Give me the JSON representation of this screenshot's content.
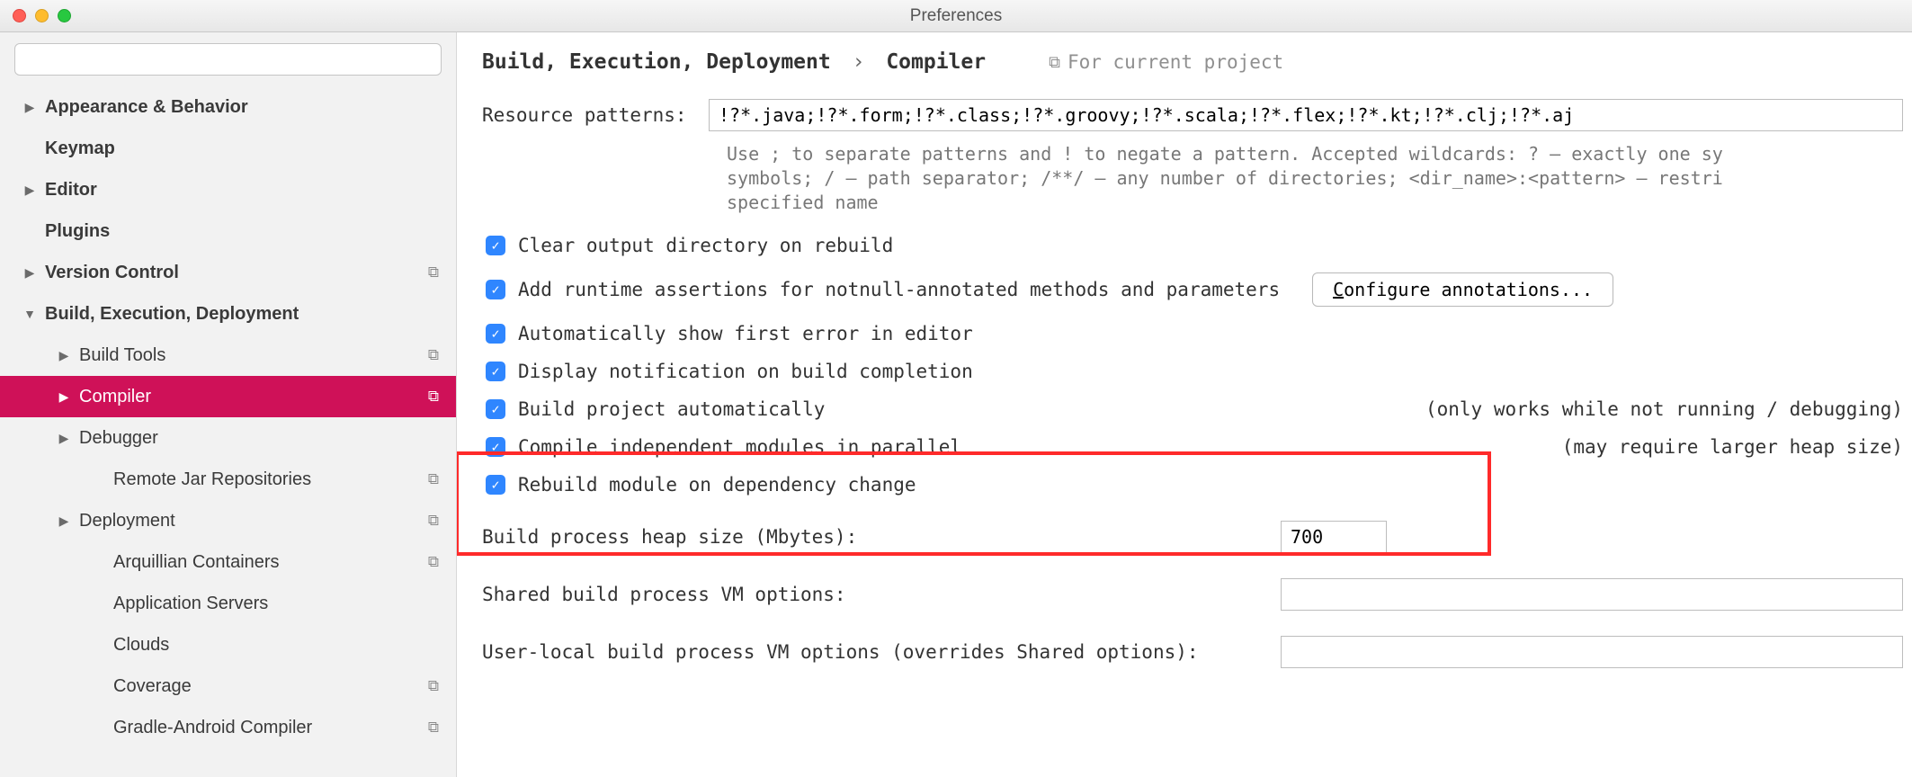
{
  "title": "Preferences",
  "search_placeholder": "",
  "sidebar": [
    {
      "label": "Appearance & Behavior",
      "bold": true,
      "arrow": "right",
      "lvl": 1
    },
    {
      "label": "Keymap",
      "bold": true,
      "arrow": "none",
      "lvl": 1
    },
    {
      "label": "Editor",
      "bold": true,
      "arrow": "right",
      "lvl": 1
    },
    {
      "label": "Plugins",
      "bold": true,
      "arrow": "none",
      "lvl": 1
    },
    {
      "label": "Version Control",
      "bold": true,
      "arrow": "right",
      "lvl": 1,
      "scope": true
    },
    {
      "label": "Build, Execution, Deployment",
      "bold": true,
      "arrow": "down",
      "lvl": 1
    },
    {
      "label": "Build Tools",
      "arrow": "right",
      "lvl": 2,
      "scope": true
    },
    {
      "label": "Compiler",
      "arrow": "right",
      "lvl": 2,
      "scope": true,
      "selected": true
    },
    {
      "label": "Debugger",
      "arrow": "right",
      "lvl": 2
    },
    {
      "label": "Remote Jar Repositories",
      "arrow": "none",
      "lvl": 3,
      "scope": true
    },
    {
      "label": "Deployment",
      "arrow": "right",
      "lvl": 2,
      "scope": true
    },
    {
      "label": "Arquillian Containers",
      "arrow": "none",
      "lvl": 3,
      "scope": true
    },
    {
      "label": "Application Servers",
      "arrow": "none",
      "lvl": 3
    },
    {
      "label": "Clouds",
      "arrow": "none",
      "lvl": 3
    },
    {
      "label": "Coverage",
      "arrow": "none",
      "lvl": 3,
      "scope": true
    },
    {
      "label": "Gradle-Android Compiler",
      "arrow": "none",
      "lvl": 3,
      "scope": true
    }
  ],
  "breadcrumb": {
    "a": "Build, Execution, Deployment",
    "sep": "›",
    "b": "Compiler"
  },
  "scope_tag": "For current project",
  "resource": {
    "label": "Resource patterns:",
    "value": "!?*.java;!?*.form;!?*.class;!?*.groovy;!?*.scala;!?*.flex;!?*.kt;!?*.clj;!?*.aj",
    "help1": "Use ; to separate patterns and ! to negate a pattern. Accepted wildcards: ? — exactly one sy",
    "help2": "symbols; / — path separator; /**/ — any number of directories; <dir_name>:<pattern> — restri",
    "help3": "specified name"
  },
  "checks": {
    "c1": "Clear output directory on rebuild",
    "c2": "Add runtime assertions for notnull-annotated methods and parameters",
    "c2btn_pre": "C",
    "c2btn_rest": "onfigure annotations...",
    "c3": "Automatically show first error in editor",
    "c4": "Display notification on build completion",
    "c5": "Build project automatically",
    "c5note": "(only works while not running / debugging)",
    "c6": "Compile independent modules in parallel",
    "c6note": "(may require larger heap size)",
    "c7": "Rebuild module on dependency change"
  },
  "heap": {
    "label": "Build process heap size (Mbytes):",
    "value": "700"
  },
  "sharedvm": {
    "label": "Shared build process VM options:",
    "value": ""
  },
  "localvm": {
    "label": "User-local build process VM options (overrides Shared options):",
    "value": ""
  }
}
